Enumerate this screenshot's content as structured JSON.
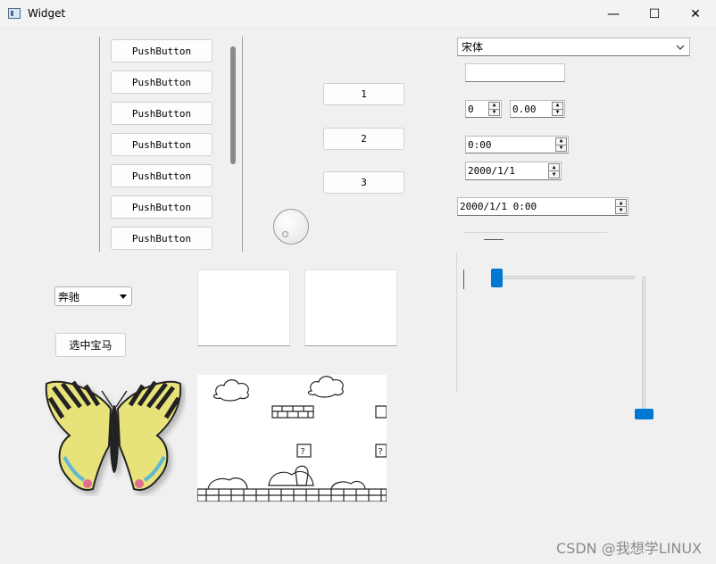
{
  "window": {
    "title": "Widget",
    "minimize_glyph": "—",
    "maximize_glyph": "☐",
    "close_glyph": "✕"
  },
  "left_buttons": [
    "PushButton",
    "PushButton",
    "PushButton",
    "PushButton",
    "PushButton",
    "PushButton",
    "PushButton"
  ],
  "number_buttons": [
    "1",
    "2",
    "3"
  ],
  "font_combo": {
    "value": "宋体"
  },
  "spin_int": {
    "value": "0"
  },
  "spin_double": {
    "value": "0.00"
  },
  "time_edit": {
    "value": "0:00"
  },
  "date_edit": {
    "value": "2000/1/1"
  },
  "datetime_edit": {
    "value": "2000/1/1 0:00"
  },
  "car_combo": {
    "value": "奔驰"
  },
  "select_button": {
    "label": "选中宝马"
  },
  "watermark": "CSDN @我想学LINUX",
  "sliders": {
    "horizontal_level": 0.0,
    "vertical_level": 0.0
  },
  "colors": {
    "accent": "#0078d4",
    "background": "#f0f0f0"
  }
}
